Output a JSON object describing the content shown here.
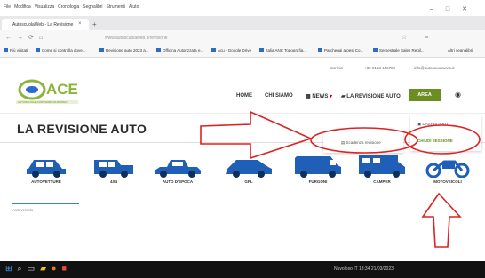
{
  "browser": {
    "menu": [
      "File",
      "Modifica",
      "Visualizza",
      "Cronologia",
      "Segnalibri",
      "Strumenti",
      "Aiuto"
    ],
    "tab_title": "AutoscuolaWeb - La Revisione",
    "url": "www.autoscuolaweb.it/revisione",
    "bookmarks": [
      "Più visitati",
      "Come si controlla dove...",
      "Revisione auto 2023 a...",
      "Officina Autorizzata e...",
      "Acu - Google Drive",
      "Italia ANC Topografia...",
      "Parcheggi a pesi Co...",
      "Semestrale Sales Regil...",
      "Altri segnalibri"
    ]
  },
  "site": {
    "contact": [
      "Scrivici",
      "+39 0123 456789",
      "info@autoscuolaweb.it"
    ],
    "logo_text": "ACE",
    "logo_sub": "AUTOSCUOLE CONSORZIO EUROPEO",
    "nav": [
      "HOME",
      "CHI SIAMO",
      "NEWS",
      "LA REVISIONE AUTO"
    ],
    "area_button": "AREA UTENTI",
    "page_title": "LA REVISIONE AUTO",
    "dropdown_main": "Scadenza revisione",
    "dropdown_user": [
      "DASHBOARD",
      "CHIUDI SESSIONE"
    ],
    "categories": [
      "AUTOVETTURE",
      "4X4",
      "AUTO D'EPOCA",
      "GPL",
      "FURGONI",
      "CAMPER",
      "MOTOVEICOLI"
    ],
    "sub_label": "Autoveicolo"
  },
  "taskbar": {
    "tray": "Nuvoloso  IT  13:34  21/03/2023"
  },
  "colors": {
    "accent": "#6b8e23",
    "car": "#1f5fb8",
    "arrow": "#e02020"
  }
}
